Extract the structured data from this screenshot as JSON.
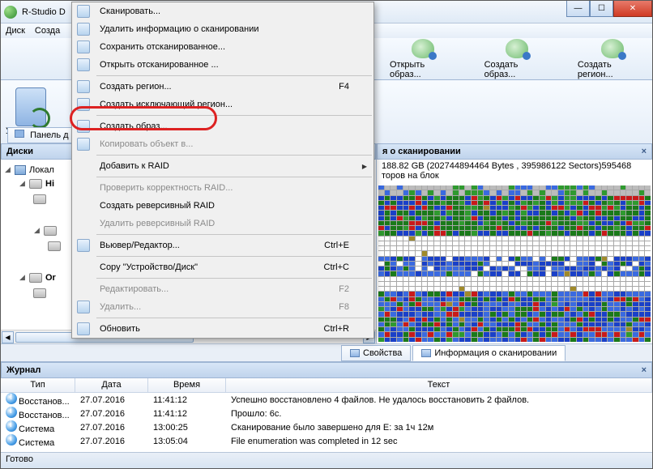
{
  "title": "R-Studio D",
  "menubar": {
    "disk": "Диск",
    "create": "Созда"
  },
  "toolbar": {
    "open_image": "Открыть образ...",
    "create_image": "Создать образ...",
    "create_region": "Создать регион..."
  },
  "deleted_label": "Удаленное по",
  "panel_button": "Панель д",
  "left_panel_title": "Диски",
  "tree": {
    "local": "Локал",
    "hi": "Hi",
    "or": "Or"
  },
  "right_panel_title": "я о сканировании",
  "scan_info_line": "188.82 GB (202744894464 Bytes , 395986122 Sectors)595468",
  "scan_info_line2": "торов на блок",
  "tabs": {
    "props": "Свойства",
    "scan": "Информация о сканировании"
  },
  "journal": {
    "title": "Журнал",
    "cols": {
      "type": "Тип",
      "date": "Дата",
      "time": "Время",
      "text": "Текст"
    },
    "rows": [
      {
        "icon": "w",
        "type": "Восстанов...",
        "date": "27.07.2016",
        "time": "11:41:12",
        "text": "Успешно восстановлено 4 файлов. Не удалось восстановить 2 файлов."
      },
      {
        "icon": "i",
        "type": "Восстанов...",
        "date": "27.07.2016",
        "time": "11:41:12",
        "text": "Прошло: 6с."
      },
      {
        "icon": "i",
        "type": "Система",
        "date": "27.07.2016",
        "time": "13:00:25",
        "text": "Сканирование было завершено для E: за 1ч 12м"
      },
      {
        "icon": "i",
        "type": "Система",
        "date": "27.07.2016",
        "time": "13:05:04",
        "text": "File enumeration was completed in 12 sec"
      }
    ]
  },
  "status": "Готово",
  "ctx": {
    "scan": "Сканировать...",
    "del_scan_info": "Удалить информацию о сканировании",
    "save_scan": "Сохранить отсканированное...",
    "open_scan": "Открыть отсканированное ...",
    "create_region": "Создать регион...",
    "create_region_sc": "F4",
    "create_excl_region": "Создать исключающий регион...",
    "create_image": "Создать образ...",
    "copy_object": "Копировать объект в...",
    "add_to_raid": "Добавить к RAID",
    "check_raid": "Проверить корректность RAID...",
    "create_rev_raid": "Создать реверсивный RAID",
    "del_rev_raid": "Удалить реверсивный RAID",
    "viewer": "Вьювер/Редактор...",
    "viewer_sc": "Ctrl+E",
    "copy": "Copy \"Устройство/Диск\"",
    "copy_sc": "Ctrl+C",
    "edit": "Редактировать...",
    "edit_sc": "F2",
    "delete": "Удалить...",
    "delete_sc": "F8",
    "refresh": "Обновить",
    "refresh_sc": "Ctrl+R"
  }
}
